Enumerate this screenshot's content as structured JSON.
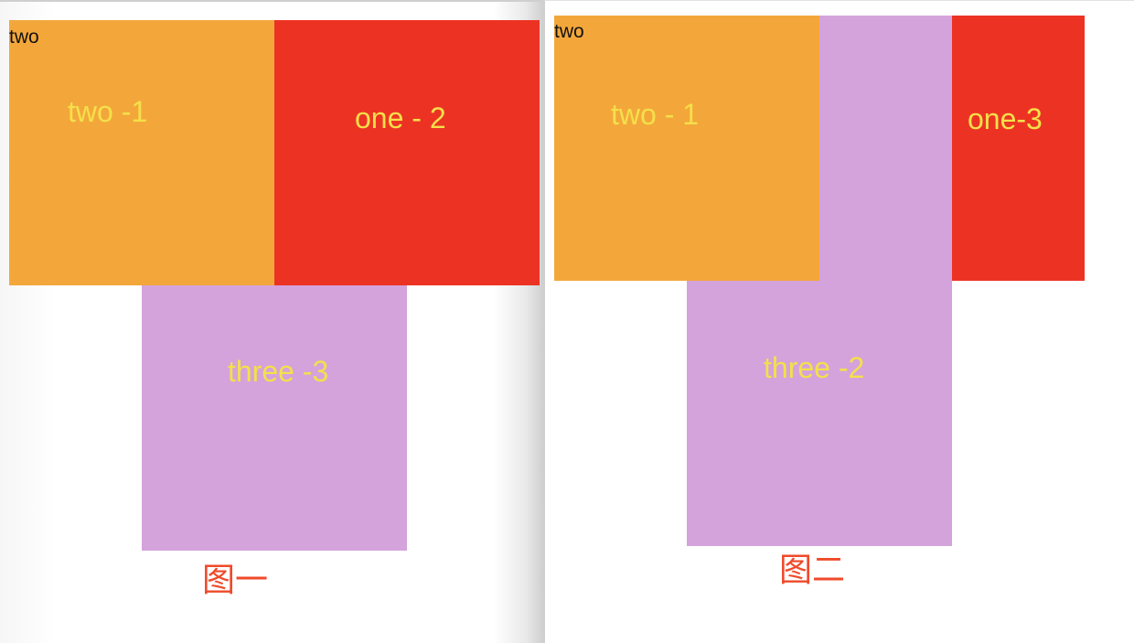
{
  "colors": {
    "orange": "#f3a73b",
    "red": "#ec3323",
    "purple": "#d4a3dc",
    "box_text": "#f4e04a",
    "caption": "#ef4a2a"
  },
  "figure1": {
    "parent_label": "two",
    "box_two": "two -1",
    "box_one": "one - 2",
    "box_three": "three -3",
    "caption": "图一"
  },
  "figure2": {
    "parent_label": "two",
    "box_two": "two - 1",
    "box_three": "three -2",
    "box_one": "one-3",
    "caption": "图二"
  }
}
